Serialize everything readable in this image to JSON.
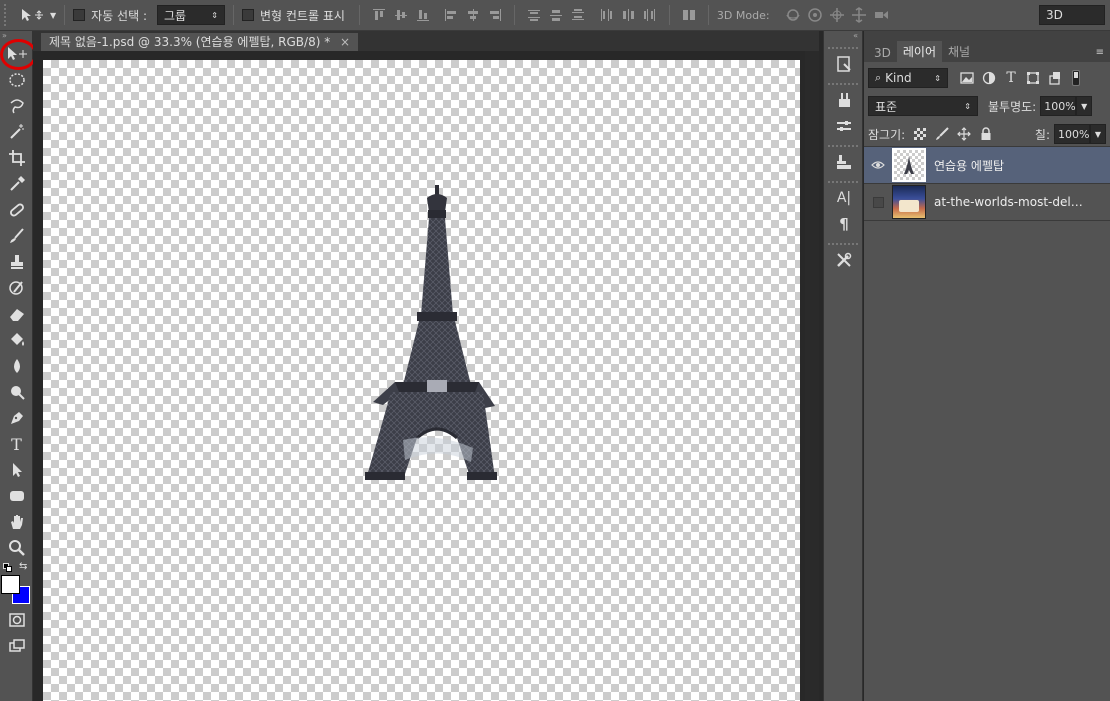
{
  "options_bar": {
    "auto_select_label": "자동 선택 :",
    "auto_select_value": "그룹",
    "transform_controls_label": "변형 컨트롤 표시",
    "mode_3d_label": "3D Mode:",
    "workspace_value": "3D"
  },
  "document": {
    "tab_title": "제목 없음-1.psd @ 33.3% (연습용 에펠탑, RGB/8) *",
    "close_glyph": "×"
  },
  "layers_panel": {
    "tabs": [
      "3D",
      "레이어",
      "채널"
    ],
    "filter_kind": "Kind",
    "blend_mode": "표준",
    "opacity_label": "불투명도:",
    "opacity_value": "100%",
    "lock_label": "잠그기:",
    "fill_label": "칠:",
    "fill_value": "100%",
    "layers": [
      {
        "name": "연습용 에펠탑",
        "visible": true,
        "selected": true
      },
      {
        "name": "at-the-worlds-most-delicio...",
        "visible": false,
        "selected": false
      }
    ]
  },
  "tools": {
    "type_glyph": "T"
  },
  "dock": {
    "char_glyph": "A|",
    "para_glyph": "¶"
  },
  "colors": {
    "foreground": "#ffffff",
    "background": "#0000ff",
    "highlight_ring": "#e00000",
    "selected_layer": "#56627a"
  }
}
